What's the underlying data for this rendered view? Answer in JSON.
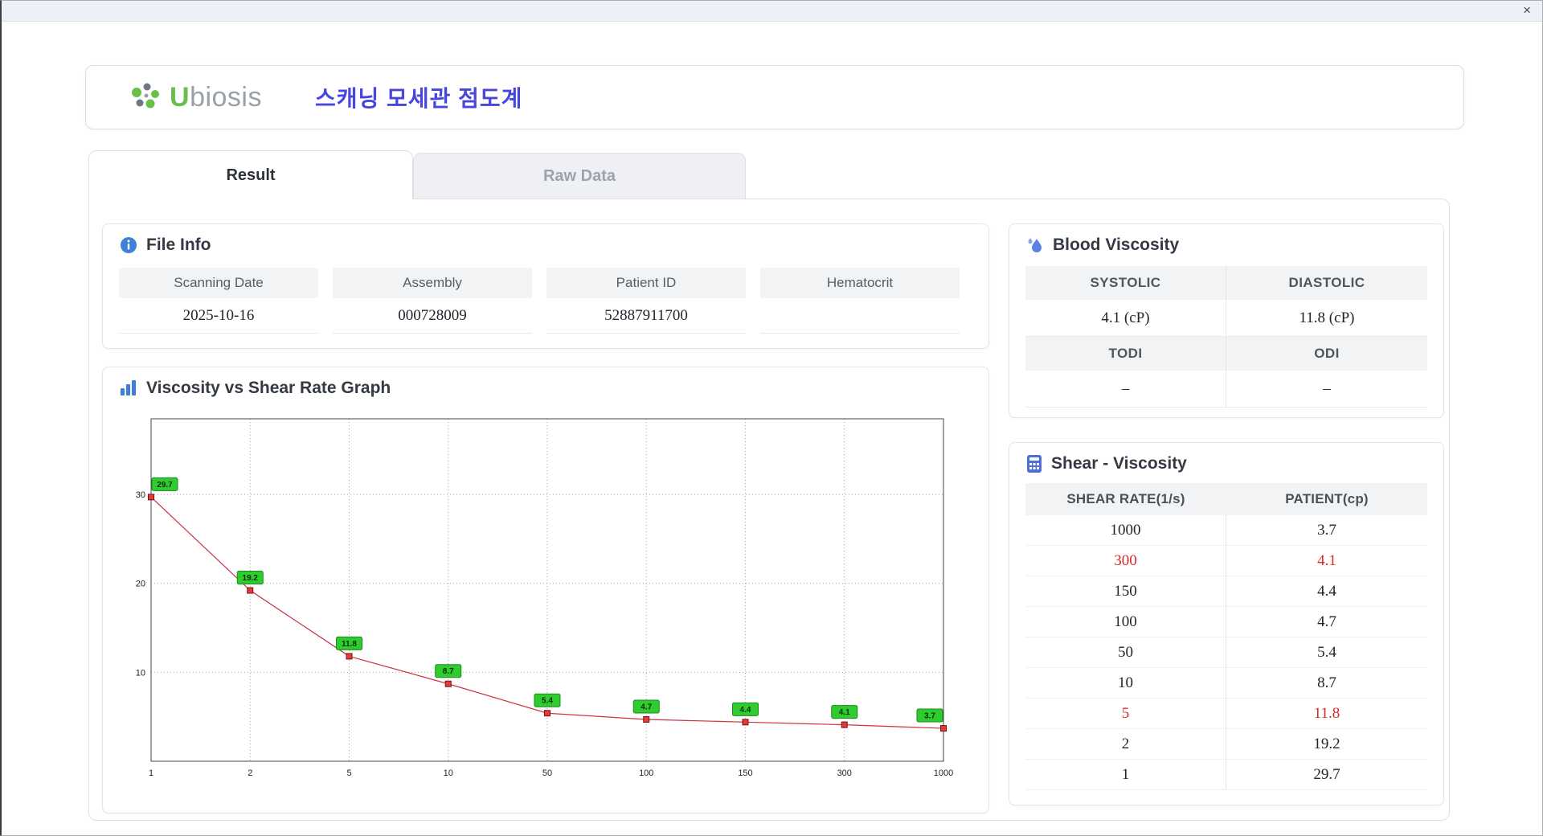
{
  "window": {
    "close_label": "×"
  },
  "header": {
    "logo_u": "U",
    "logo_rest": "biosis",
    "title": "스캐닝 모세관 점도계"
  },
  "tabs": [
    {
      "label": "Result",
      "active": true
    },
    {
      "label": "Raw Data",
      "active": false
    }
  ],
  "file_info": {
    "title": "File Info",
    "fields": [
      {
        "label": "Scanning Date",
        "value": "2025-10-16"
      },
      {
        "label": "Assembly",
        "value": "000728009"
      },
      {
        "label": "Patient ID",
        "value": "52887911700"
      },
      {
        "label": "Hematocrit",
        "value": ""
      }
    ]
  },
  "graph": {
    "title": "Viscosity vs Shear Rate Graph"
  },
  "chart_data": {
    "type": "line",
    "title": "Viscosity vs Shear Rate Graph",
    "x": [
      1,
      2,
      5,
      10,
      50,
      100,
      150,
      300,
      1000
    ],
    "values": [
      29.7,
      19.2,
      11.8,
      8.7,
      5.4,
      4.7,
      4.4,
      4.1,
      3.7
    ],
    "point_labels": [
      "29.7",
      "19.2",
      "11.8",
      "8.7",
      "5.4",
      "4.7",
      "4.4",
      "4.1",
      "3.7"
    ],
    "yticks": [
      10,
      20,
      30
    ],
    "ylim": [
      0,
      38.5
    ],
    "x_axis_type": "categorical-equal-spacing",
    "grid": "dotted",
    "line_color": "#cc3040",
    "point_color": "#e23b3b",
    "label_bg": "#2fcc2f",
    "label_border": "#1d8a1d"
  },
  "blood_viscosity": {
    "title": "Blood Viscosity",
    "rows": [
      {
        "labels": [
          "SYSTOLIC",
          "DIASTOLIC"
        ],
        "values": [
          "4.1 (cP)",
          "11.8 (cP)"
        ]
      },
      {
        "labels": [
          "TODI",
          "ODI"
        ],
        "values": [
          "–",
          "–"
        ]
      }
    ]
  },
  "shear_viscosity": {
    "title": "Shear - Viscosity",
    "columns": [
      "SHEAR RATE(1/s)",
      "PATIENT(cp)"
    ],
    "rows": [
      {
        "shear": "1000",
        "patient": "3.7",
        "highlight": false
      },
      {
        "shear": "300",
        "patient": "4.1",
        "highlight": true
      },
      {
        "shear": "150",
        "patient": "4.4",
        "highlight": false
      },
      {
        "shear": "100",
        "patient": "4.7",
        "highlight": false
      },
      {
        "shear": "50",
        "patient": "5.4",
        "highlight": false
      },
      {
        "shear": "10",
        "patient": "8.7",
        "highlight": false
      },
      {
        "shear": "5",
        "patient": "11.8",
        "highlight": true
      },
      {
        "shear": "2",
        "patient": "19.2",
        "highlight": false
      },
      {
        "shear": "1",
        "patient": "29.7",
        "highlight": false
      }
    ]
  }
}
